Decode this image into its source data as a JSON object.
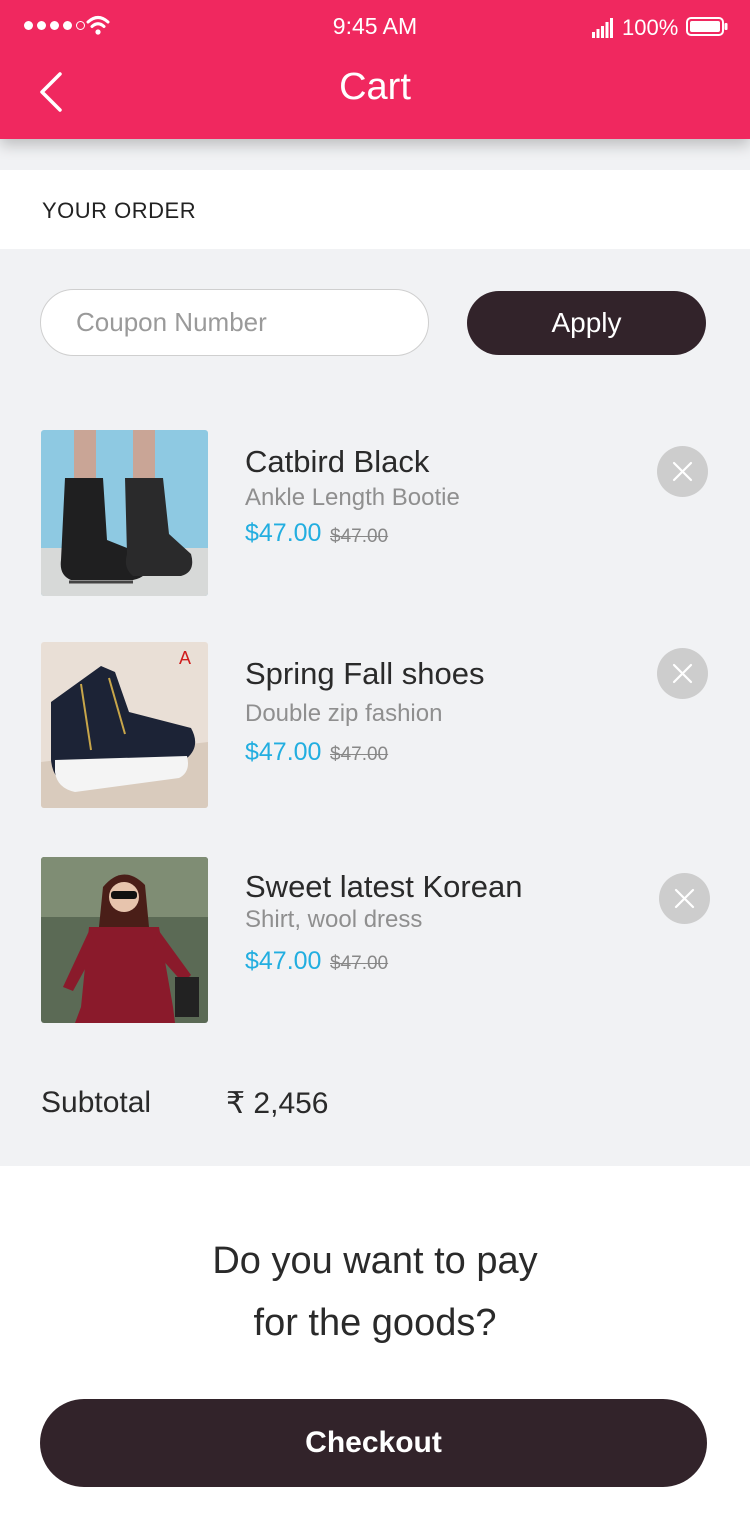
{
  "status_bar": {
    "time": "9:45 AM",
    "battery": "100%"
  },
  "header": {
    "title": "Cart",
    "back_icon": "chevron-left-icon"
  },
  "order": {
    "label": "YOUR ORDER"
  },
  "coupon": {
    "placeholder": "Coupon Number",
    "apply_label": "Apply"
  },
  "items": [
    {
      "name": "Catbird Black",
      "subtitle": "Ankle Length Bootie",
      "price": "$47.00",
      "old_price": "$47.00"
    },
    {
      "name": "Spring Fall shoes",
      "subtitle": "Double zip fashion",
      "price": "$47.00",
      "old_price": "$47.00"
    },
    {
      "name": "Sweet latest Korean",
      "subtitle": "Shirt, wool dress",
      "price": "$47.00",
      "old_price": "$47.00"
    }
  ],
  "summary": {
    "subtotal_label": "Subtotal",
    "subtotal_value": "₹ 2,456"
  },
  "payment": {
    "question_line1": "Do you want to pay",
    "question_line2": "for the goods?",
    "checkout_label": "Checkout"
  },
  "colors": {
    "header": "#f0285f",
    "dark_button": "#32232a",
    "price": "#22aee0",
    "background": "#f1f2f4"
  }
}
